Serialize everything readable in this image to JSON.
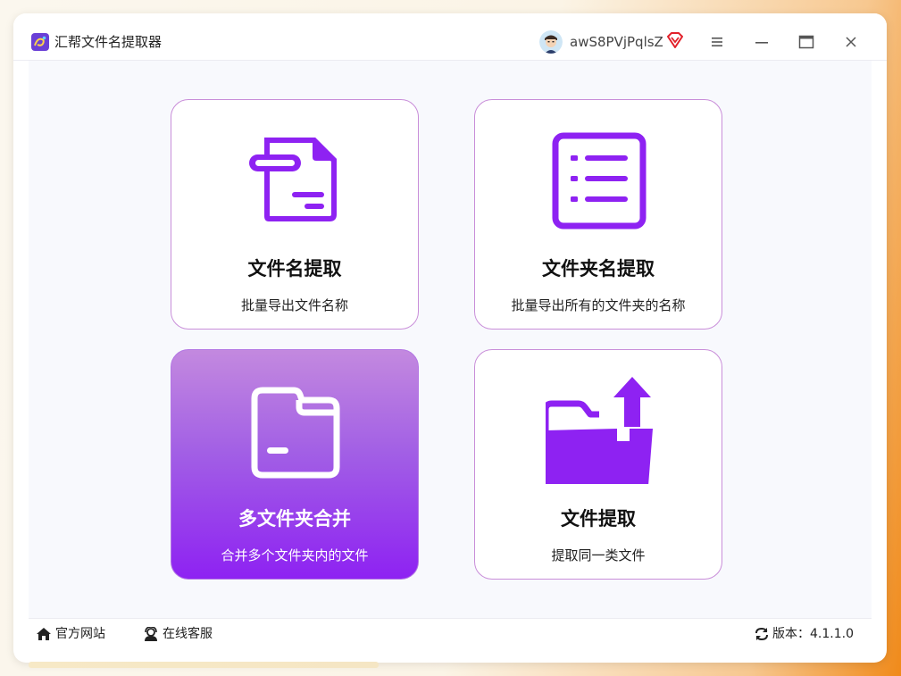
{
  "window": {
    "title": "汇帮文件名提取器",
    "user": {
      "name": "awS8PVjPqlsZ"
    }
  },
  "icons": {
    "app_logo": "huibang-logo",
    "avatar": "user-avatar",
    "vip": "vip-diamond-icon",
    "menu": "hamburger-menu-icon",
    "minimize": "minimize-icon",
    "maximize": "maximize-icon",
    "close": "close-icon"
  },
  "cards": [
    {
      "title": "文件名提取",
      "subtitle": "批量导出文件名称",
      "icon": "document-icon",
      "active": false
    },
    {
      "title": "文件夹名提取",
      "subtitle": "批量导出所有的文件夹的名称",
      "icon": "list-icon",
      "active": false
    },
    {
      "title": "多文件夹合并",
      "subtitle": "合并多个文件夹内的文件",
      "icon": "folder-icon",
      "active": true
    },
    {
      "title": "文件提取",
      "subtitle": "提取同一类文件",
      "icon": "folder-upload-icon",
      "active": false
    }
  ],
  "footer": {
    "website": "官方网站",
    "support": "在线客服",
    "version_label": "版本：",
    "version": "4.1.1.0"
  },
  "colors": {
    "accent": "#8e22f2",
    "card_border": "#c98ed9",
    "active_gradient_top": "#c389df",
    "active_gradient_bottom": "#8e22f2",
    "vip_red": "#e2202a"
  }
}
